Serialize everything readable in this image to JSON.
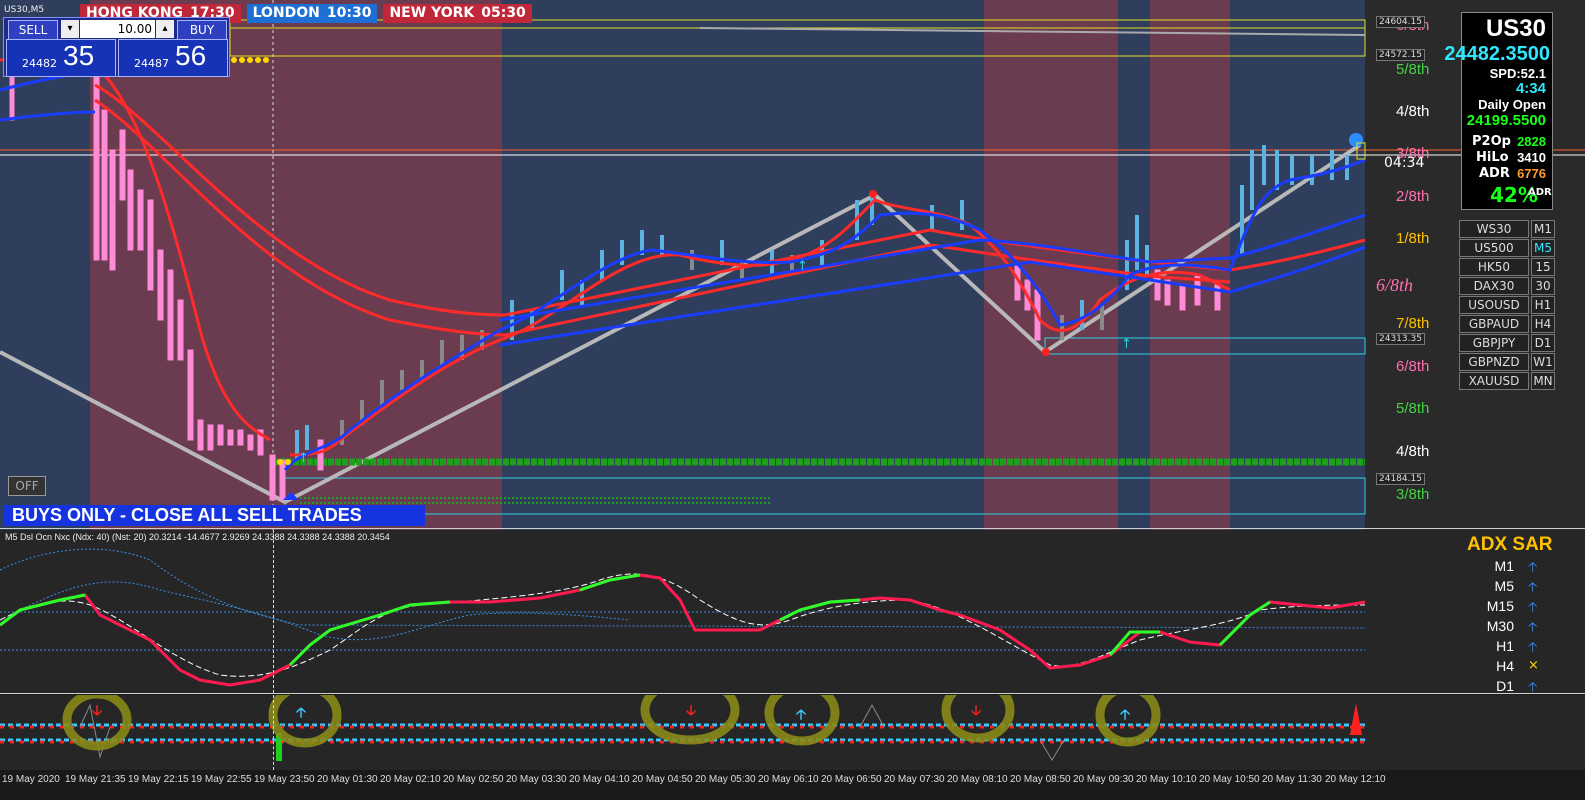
{
  "chart": {
    "symbol_label": "US30,M5",
    "sessions": [
      {
        "city": "HONG KONG",
        "time": "17:30",
        "bg": "#c0283a"
      },
      {
        "city": "LONDON",
        "time": "10:30",
        "bg": "#1d6fd4"
      },
      {
        "city": "NEW YORK",
        "time": "05:30",
        "bg": "#c0283a"
      }
    ]
  },
  "trade_panel": {
    "sell_label": "SELL",
    "buy_label": "BUY",
    "lot_value": "10.00",
    "sell_small": "24482",
    "sell_big": "35",
    "buy_small": "24487",
    "buy_big": "56"
  },
  "info_box": {
    "symbol": "US30",
    "price": "24482.3500",
    "spread": "SPD:52.1",
    "timer": "4:34",
    "daily_open_label": "Daily Open",
    "daily_open_value": "24199.5500",
    "p2op_label": "P2Op",
    "p2op_value": "2828",
    "hilo_label": "HiLo",
    "hilo_value": "3410",
    "adr_label": "ADR",
    "adr_value": "6776",
    "adr_percent": "42%",
    "adr_suffix": "ADR"
  },
  "symbols": [
    {
      "name": "WS30",
      "tf": "M1"
    },
    {
      "name": "US500",
      "tf": "M5"
    },
    {
      "name": "HK50",
      "tf": "15"
    },
    {
      "name": "DAX30",
      "tf": "30"
    },
    {
      "name": "USOUSD",
      "tf": "H1"
    },
    {
      "name": "GBPAUD",
      "tf": "H4"
    },
    {
      "name": "GBPJPY",
      "tf": "D1"
    },
    {
      "name": "GBPNZD",
      "tf": "W1"
    },
    {
      "name": "XAUUSD",
      "tf": "MN"
    }
  ],
  "octaves": [
    {
      "label": "6/8th",
      "color": "#ff6fb0"
    },
    {
      "label": "5/8th",
      "color": "#44d244"
    },
    {
      "label": "4/8th",
      "color": "#ffffff"
    },
    {
      "label": "3/8th",
      "color": "#ff6fb0"
    },
    {
      "label": "2/8th",
      "color": "#ff6fb0"
    },
    {
      "label": "1/8th",
      "color": "#ffc000"
    },
    {
      "label": "7/8th",
      "color": "#ffc000"
    },
    {
      "label": "6/8th",
      "color": "#ff6fb0"
    },
    {
      "label": "5/8th",
      "color": "#44d244"
    },
    {
      "label": "4/8th",
      "color": "#ffffff"
    },
    {
      "label": "3/8th",
      "color": "#44d244"
    }
  ],
  "octave_italic": "6/8th",
  "price_tags": [
    "24604.15",
    "24572.15",
    "04:34",
    "24313.35",
    "24184.15"
  ],
  "banner": "BUYS ONLY - CLOSE ALL SELL TRADES",
  "off_label": "OFF",
  "indicator": {
    "header": "M5 Dsl Ocn Nxc (Ndx: 40) (Nst: 20) 20.3214 -14.4677 2.9269 24.3388 24.3388 24.3388 20.3454",
    "adx_title": "ADX SAR",
    "adx_rows": [
      {
        "tf": "M1",
        "icon": "arrow-up",
        "symbol": "🡡"
      },
      {
        "tf": "M5",
        "icon": "arrow-up",
        "symbol": "🡡"
      },
      {
        "tf": "M15",
        "icon": "arrow-up",
        "symbol": "🡡"
      },
      {
        "tf": "M30",
        "icon": "arrow-up",
        "symbol": "🡡"
      },
      {
        "tf": "H1",
        "icon": "arrow-up",
        "symbol": "🡡"
      },
      {
        "tf": "H4",
        "icon": "cross",
        "symbol": "×"
      },
      {
        "tf": "D1",
        "icon": "arrow-up",
        "symbol": "🡡"
      }
    ]
  },
  "time_axis": [
    "19 May 2020",
    "19 May 21:35",
    "19 May 22:15",
    "19 May 22:55",
    "19 May 23:50",
    "20 May 01:30",
    "20 May 02:10",
    "20 May 02:50",
    "20 May 03:30",
    "20 May 04:10",
    "20 May 04:50",
    "20 May 05:30",
    "20 May 06:10",
    "20 May 06:50",
    "20 May 07:30",
    "20 May 08:10",
    "20 May 08:50",
    "20 May 09:30",
    "20 May 10:10",
    "20 May 10:50",
    "20 May 11:30",
    "20 May 12:10"
  ]
}
